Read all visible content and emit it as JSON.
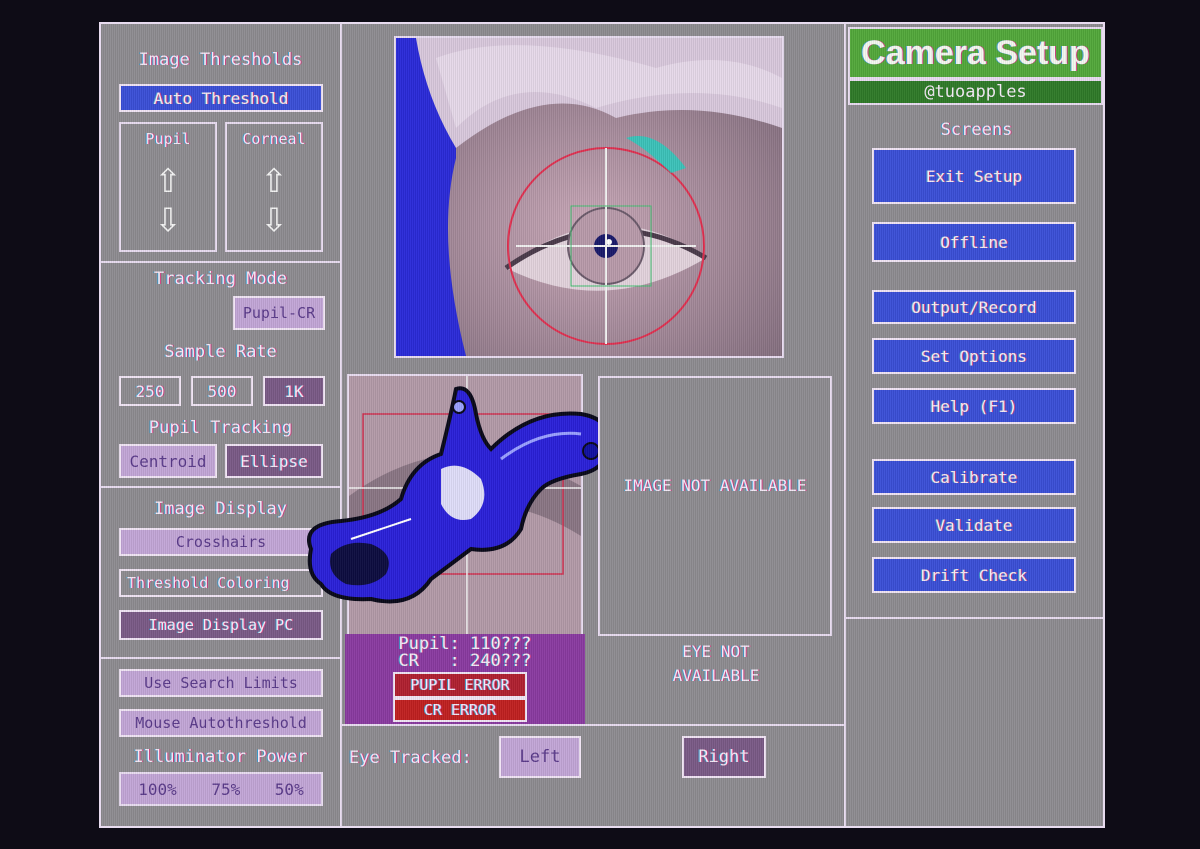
{
  "left_panel": {
    "image_thresholds": {
      "title": "Image Thresholds",
      "auto_threshold": "Auto Threshold",
      "pupil": "Pupil",
      "corneal": "Corneal",
      "up_arrow": "⇧",
      "down_arrow": "⇩"
    },
    "tracking_mode": {
      "title": "Tracking Mode",
      "value": "Pupil-CR"
    },
    "sample_rate": {
      "title": "Sample Rate",
      "options": [
        "250",
        "500",
        "1K"
      ]
    },
    "pupil_tracking": {
      "title": "Pupil Tracking",
      "options": [
        "Centroid",
        "Ellipse"
      ]
    },
    "image_display": {
      "title": "Image Display",
      "crosshairs": "Crosshairs",
      "threshold_coloring": "Threshold Coloring",
      "image_display_pc": "Image Display PC"
    },
    "search": {
      "use_search_limits": "Use Search Limits",
      "mouse_autothreshold": "Mouse Autothreshold",
      "illuminator_title": "Illuminator Power",
      "illuminator_options": [
        "100%",
        "75%",
        "50%"
      ]
    }
  },
  "center": {
    "status": {
      "pupil": "Pupil: 110???",
      "cr": "CR   : 240???",
      "pupil_error": "PUPIL ERROR",
      "cr_error": "CR ERROR"
    },
    "image_not_available": "IMAGE NOT AVAILABLE",
    "eye_not_available": "EYE NOT AVAILABLE",
    "eye_tracked_label": "Eye Tracked:",
    "eye_left": "Left",
    "eye_right": "Right"
  },
  "right_panel": {
    "title": "Camera Setup",
    "handle": "@tuoapples",
    "screens_label": "Screens",
    "buttons": [
      "Exit Setup",
      "Offline",
      "Output/Record",
      "Set Options",
      "Help (F1)",
      "Calibrate",
      "Validate",
      "Drift Check"
    ]
  },
  "colors": {
    "panel_grey": "#8e8c91",
    "button_blue": "#3a4fd6",
    "lavender": "#c2a6d6",
    "purple_status": "#8a3aa0",
    "error_red": "#c02020",
    "title_green": "#52a83a"
  }
}
